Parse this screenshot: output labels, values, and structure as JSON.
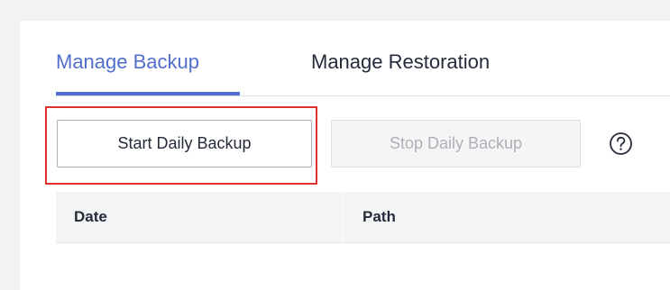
{
  "tabs": [
    {
      "label": "Manage Backup",
      "active": true
    },
    {
      "label": "Manage Restoration",
      "active": false
    }
  ],
  "toolbar": {
    "start_label": "Start Daily Backup",
    "stop_label": "Stop Daily Backup",
    "help_icon": "question-circle-icon"
  },
  "table": {
    "columns": [
      "Date",
      "Path"
    ],
    "rows": []
  },
  "colors": {
    "accent": "#526ecc",
    "highlight": "#e03030"
  }
}
